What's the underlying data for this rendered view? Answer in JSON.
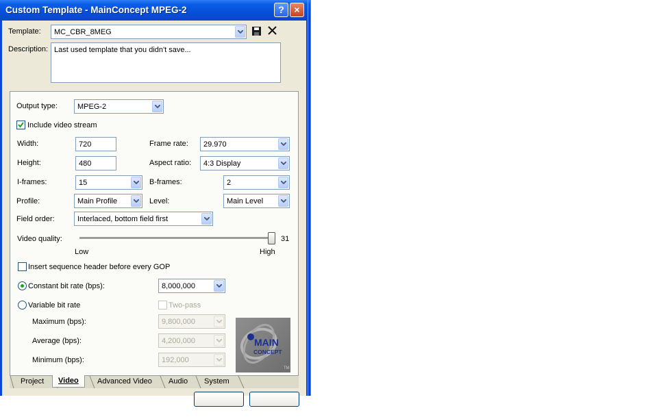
{
  "window": {
    "title": "Custom Template - MainConcept MPEG-2",
    "help_glyph": "?",
    "close_glyph": "×"
  },
  "template": {
    "label": "Template:",
    "value": "MC_CBR_8MEG"
  },
  "description": {
    "label": "Description:",
    "value": "Last used template that you didn't save..."
  },
  "output_type": {
    "label": "Output type:",
    "value": "MPEG-2"
  },
  "include_video": {
    "label": "Include video stream",
    "checked": true
  },
  "width": {
    "label": "Width:",
    "value": "720"
  },
  "height": {
    "label": "Height:",
    "value": "480"
  },
  "frame_rate": {
    "label": "Frame rate:",
    "value": "29.970"
  },
  "aspect_ratio": {
    "label": "Aspect ratio:",
    "value": "4:3 Display"
  },
  "i_frames": {
    "label": "I-frames:",
    "value": "15"
  },
  "b_frames": {
    "label": "B-frames:",
    "value": "2"
  },
  "profile": {
    "label": "Profile:",
    "value": "Main Profile"
  },
  "level": {
    "label": "Level:",
    "value": "Main Level"
  },
  "field_order": {
    "label": "Field order:",
    "value": "Interlaced, bottom field first"
  },
  "video_quality": {
    "label": "Video quality:",
    "value": "31",
    "low": "Low",
    "high": "High",
    "level_fraction": 1.0
  },
  "seq_header": {
    "label": "Insert sequence header before every GOP",
    "checked": false
  },
  "cbr": {
    "label": "Constant bit rate (bps):",
    "value": "8,000,000",
    "selected": true
  },
  "vbr": {
    "label": "Variable bit rate",
    "selected": false
  },
  "two_pass": {
    "label": "Two-pass",
    "checked": false
  },
  "maximum": {
    "label": "Maximum (bps):",
    "value": "9,800,000"
  },
  "average": {
    "label": "Average (bps):",
    "value": "4,200,000"
  },
  "minimum": {
    "label": "Minimum (bps):",
    "value": "192,000"
  },
  "logo": {
    "line1": "MAIN",
    "line2": "CONCEPT",
    "tm": "TM"
  },
  "tabs": [
    {
      "label": "Project",
      "active": false
    },
    {
      "label": "Video",
      "active": true
    },
    {
      "label": "Advanced Video",
      "active": false
    },
    {
      "label": "Audio",
      "active": false
    },
    {
      "label": "System",
      "active": false
    }
  ],
  "colors": {
    "titlebar": "#0a5ae0",
    "dialog_bg": "#ece9d8",
    "radio_dot": "#21a121"
  }
}
